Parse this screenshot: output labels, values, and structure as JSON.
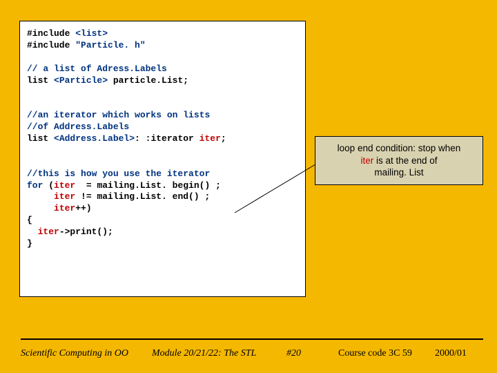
{
  "code": {
    "l1a": "#include ",
    "l1b": "<list>",
    "l2a": "#include ",
    "l2b": "\"Particle. h\"",
    "c1": "// a list of Adress.Labels",
    "l3a": "list ",
    "l3b": "<Particle>",
    "l3c": " particle.List;",
    "c2": "//an iterator which works on lists",
    "c3": "//of Address.Labels",
    "l4a": "list ",
    "l4b": "<Address.Label>",
    "l4c": ": :iterator ",
    "l4d": "iter",
    "l4e": ";",
    "c4": "//this is how you use the iterator",
    "l5a": "for ",
    "l5b": "(",
    "l5c": "iter",
    "l5d": "  = mailing.List. begin() ;",
    "l6a": "     ",
    "l6b": "iter",
    "l6c": " != mailing.List. end() ;",
    "l7a": "     ",
    "l7b": "iter",
    "l7c": "++)",
    "l8": "{",
    "l9a": "  ",
    "l9b": "iter",
    "l9c": "->print();",
    "l10": "}"
  },
  "callout": {
    "t1": "loop end condition: stop when",
    "t2a": "iter",
    "t2b": " is at the end of",
    "t3": "mailing. List"
  },
  "footer": {
    "left": "Scientific Computing in OO",
    "mid": "Module 20/21/22: The STL",
    "num": "#20",
    "course": "Course code 3C 59",
    "year": "2000/01"
  }
}
